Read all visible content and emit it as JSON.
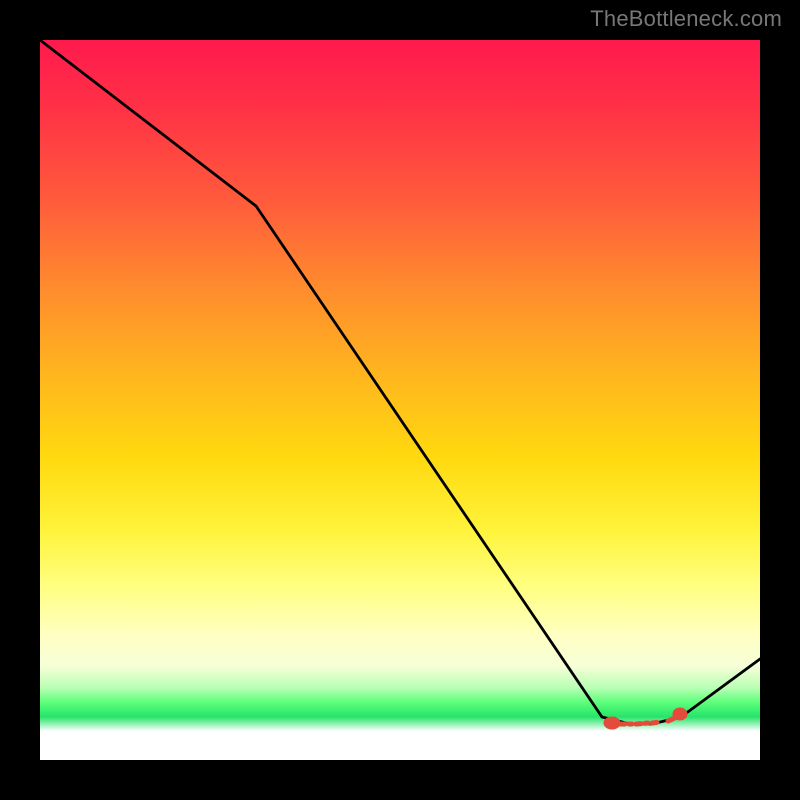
{
  "watermark": "TheBottleneck.com",
  "chart_data": {
    "type": "line",
    "title": "",
    "xlabel": "",
    "ylabel": "",
    "xlim": [
      0,
      100
    ],
    "ylim": [
      0,
      100
    ],
    "gradient_scale_note": "red=high, green≈optimal band, white=baseline floor",
    "optimal_band_y": [
      4,
      8
    ],
    "series": [
      {
        "name": "bottleneck-curve",
        "x": [
          0,
          30,
          78,
          82,
          85,
          89,
          100
        ],
        "y": [
          100,
          77,
          6,
          5,
          5,
          6,
          14
        ]
      }
    ],
    "annotations": [
      {
        "name": "optimal-marker-left",
        "x": 79.5,
        "y": 5.1,
        "color": "#e34b3a"
      },
      {
        "name": "optimal-dash",
        "x_from": 80.5,
        "x_to": 86.5,
        "y": 5.0,
        "color": "#e34b3a"
      },
      {
        "name": "optimal-marker-right",
        "x": 88.2,
        "y": 5.4,
        "color": "#e34b3a"
      }
    ]
  }
}
